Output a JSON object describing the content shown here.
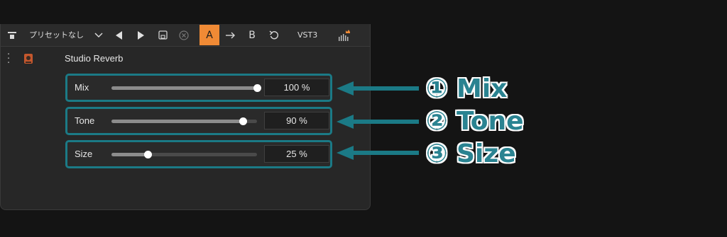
{
  "toolbar": {
    "preset_label": "プリセットなし",
    "ab_button_a": "A",
    "ab_button_b": "B",
    "format_label": "VST3"
  },
  "plugin": {
    "title": "Studio Reverb"
  },
  "params": [
    {
      "label": "Mix",
      "value": "100 %",
      "level": 1.0
    },
    {
      "label": "Tone",
      "value": "90 %",
      "level": 0.9
    },
    {
      "label": "Size",
      "value": "25 %",
      "level": 0.25
    }
  ],
  "callouts": [
    {
      "text": "① Mix"
    },
    {
      "text": "② Tone"
    },
    {
      "text": "③ Size"
    }
  ],
  "colors": {
    "accent_orange": "#f08a35",
    "highlight_teal": "#1b7a86",
    "callout_teal": "#2a8391"
  }
}
